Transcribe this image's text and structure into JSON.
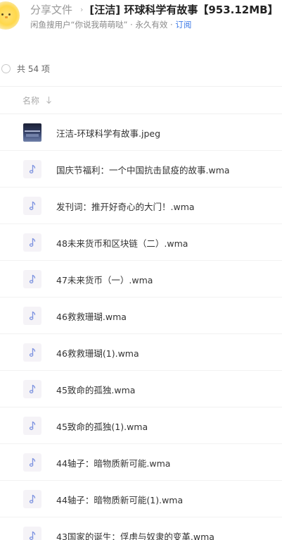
{
  "header": {
    "breadcrumb_root": "分享文件",
    "breadcrumb_separator": "›",
    "folder_title": "[汪洁] 环球科学有故事【953.12MB】",
    "sharer_text": "闲鱼搜用户“你说我萌萌哒” · 永久有效 ·",
    "subscribe_label": "订阅"
  },
  "summary": {
    "total_text": "共 54 项"
  },
  "columns": {
    "name_label": "名称"
  },
  "files": [
    {
      "name": "汪洁-环球科学有故事.jpeg",
      "icon": "image-thumbnail"
    },
    {
      "name": "国庆节福利：一个中国抗击鼠疫的故事.wma",
      "icon": "audio-file-icon"
    },
    {
      "name": "发刊词：推开好奇心的大门！.wma",
      "icon": "audio-file-icon"
    },
    {
      "name": "48未来货币和区块链（二）.wma",
      "icon": "audio-file-icon"
    },
    {
      "name": "47未来货币（一）.wma",
      "icon": "audio-file-icon"
    },
    {
      "name": "46救救珊瑚.wma",
      "icon": "audio-file-icon"
    },
    {
      "name": "46救救珊瑚(1).wma",
      "icon": "audio-file-icon"
    },
    {
      "name": "45致命的孤独.wma",
      "icon": "audio-file-icon"
    },
    {
      "name": "45致命的孤独(1).wma",
      "icon": "audio-file-icon"
    },
    {
      "name": "44轴子：暗物质新可能.wma",
      "icon": "audio-file-icon"
    },
    {
      "name": "44轴子：暗物质新可能(1).wma",
      "icon": "audio-file-icon"
    },
    {
      "name": "43国家的诞生：俘虏与奴隶的变革.wma",
      "icon": "audio-file-icon"
    }
  ],
  "colors": {
    "accent": "#3a78e6",
    "audio_icon": "#7d93e0"
  }
}
